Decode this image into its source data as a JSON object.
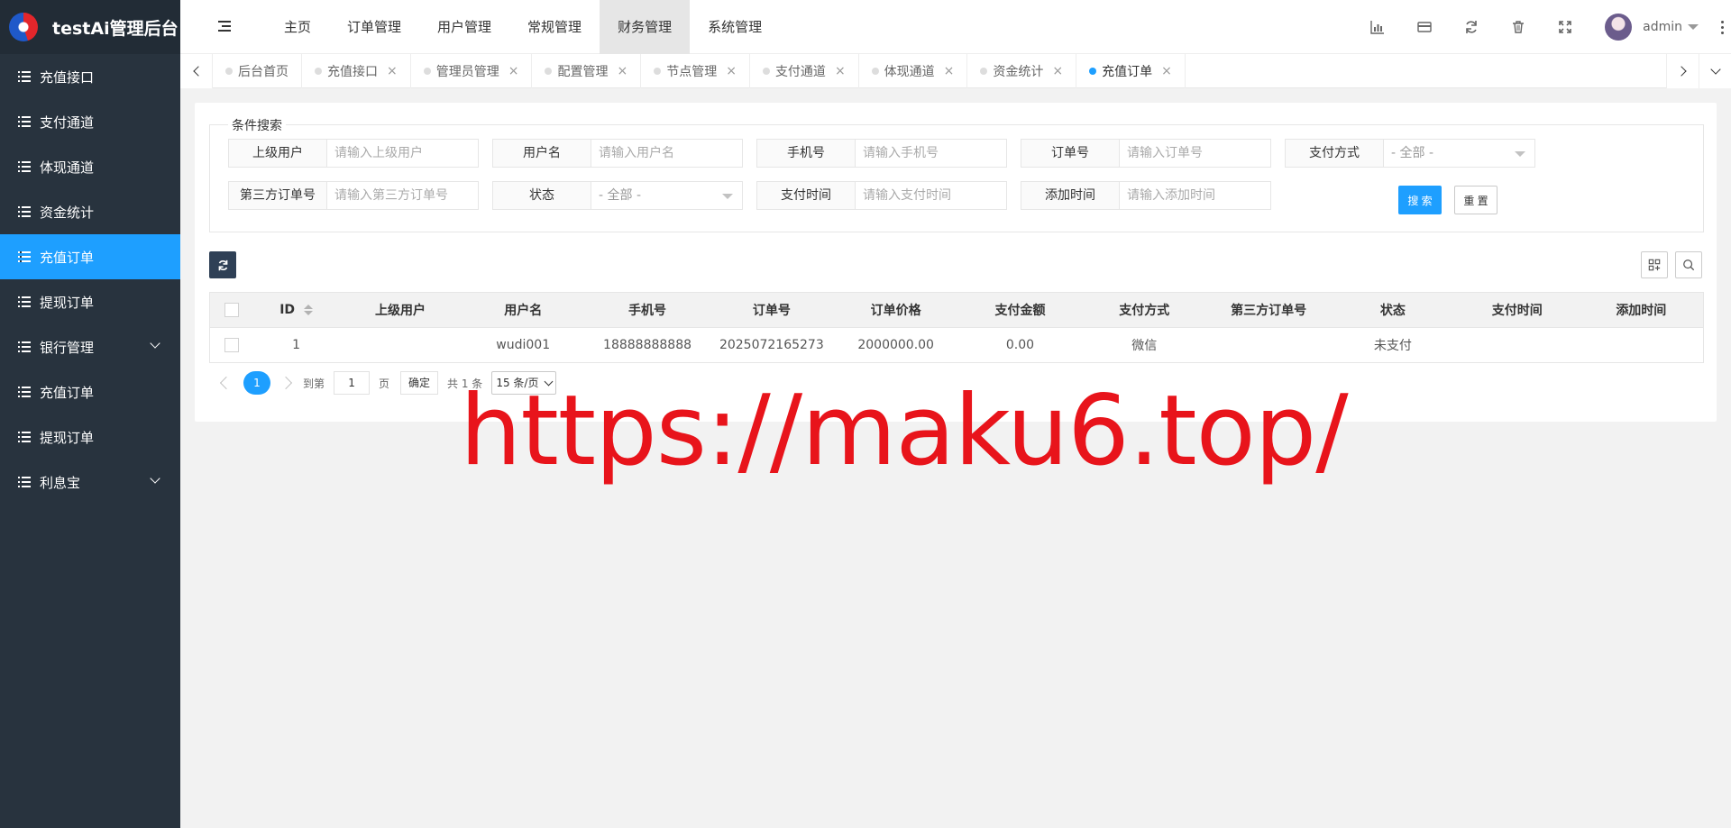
{
  "app": {
    "title": "testAi管理后台"
  },
  "sidebar": {
    "items": [
      {
        "label": "充值接口",
        "active": false,
        "expandable": false
      },
      {
        "label": "支付通道",
        "active": false,
        "expandable": false
      },
      {
        "label": "体现通道",
        "active": false,
        "expandable": false
      },
      {
        "label": "资金统计",
        "active": false,
        "expandable": false
      },
      {
        "label": "充值订单",
        "active": true,
        "expandable": false
      },
      {
        "label": "提现订单",
        "active": false,
        "expandable": false
      },
      {
        "label": "银行管理",
        "active": false,
        "expandable": true
      },
      {
        "label": "充值订单",
        "active": false,
        "expandable": false
      },
      {
        "label": "提现订单",
        "active": false,
        "expandable": false
      },
      {
        "label": "利息宝",
        "active": false,
        "expandable": true
      }
    ]
  },
  "topnav": {
    "items": [
      "主页",
      "订单管理",
      "用户管理",
      "常规管理",
      "财务管理",
      "系统管理"
    ],
    "active": "财务管理"
  },
  "header": {
    "icons": [
      "chart-icon",
      "card-icon",
      "refresh-icon",
      "trash-icon",
      "fullscreen-icon"
    ],
    "user_name": "admin"
  },
  "tabs": {
    "items": [
      {
        "label": "后台首页",
        "closable": false,
        "active": false
      },
      {
        "label": "充值接口",
        "closable": true,
        "active": false
      },
      {
        "label": "管理员管理",
        "closable": true,
        "active": false
      },
      {
        "label": "配置管理",
        "closable": true,
        "active": false
      },
      {
        "label": "节点管理",
        "closable": true,
        "active": false
      },
      {
        "label": "支付通道",
        "closable": true,
        "active": false
      },
      {
        "label": "体现通道",
        "closable": true,
        "active": false
      },
      {
        "label": "资金统计",
        "closable": true,
        "active": false
      },
      {
        "label": "充值订单",
        "closable": true,
        "active": true
      }
    ],
    "close_glyph": "×"
  },
  "search": {
    "legend": "条件搜索",
    "fields": {
      "parent_user": {
        "label": "上级用户",
        "placeholder": "请输入上级用户"
      },
      "username": {
        "label": "用户名",
        "placeholder": "请输入用户名"
      },
      "phone": {
        "label": "手机号",
        "placeholder": "请输入手机号"
      },
      "order_no": {
        "label": "订单号",
        "placeholder": "请输入订单号"
      },
      "pay_method": {
        "label": "支付方式",
        "value": "- 全部 -"
      },
      "third_order_no": {
        "label": "第三方订单号",
        "placeholder": "请输入第三方订单号"
      },
      "status": {
        "label": "状态",
        "value": "- 全部 -"
      },
      "pay_time": {
        "label": "支付时间",
        "placeholder": "请输入支付时间"
      },
      "add_time": {
        "label": "添加时间",
        "placeholder": "请输入添加时间"
      }
    },
    "search_label": "搜 索",
    "reset_label": "重 置"
  },
  "table": {
    "columns": [
      "ID",
      "上级用户",
      "用户名",
      "手机号",
      "订单号",
      "订单价格",
      "支付金额",
      "支付方式",
      "第三方订单号",
      "状态",
      "支付时间",
      "添加时间"
    ],
    "rows": [
      {
        "id": "1",
        "parent_user": "",
        "username": "wudi001",
        "phone": "18888888888",
        "order_no": "2025072165273",
        "order_price": "2000000.00",
        "pay_amount": "0.00",
        "pay_method": "微信",
        "third_order_no": "",
        "status": "未支付",
        "pay_time": "",
        "add_time": ""
      }
    ]
  },
  "pagination": {
    "current_page": "1",
    "goto_label": "到第",
    "goto_value": "1",
    "page_unit": "页",
    "ok_label": "确定",
    "total_text": "共 1 条",
    "page_size": "15 条/页"
  },
  "watermark": "https://maku6.top/",
  "colors": {
    "primary": "#1e9fff",
    "sidebar_bg": "#28333e",
    "watermark": "#e8141b"
  }
}
